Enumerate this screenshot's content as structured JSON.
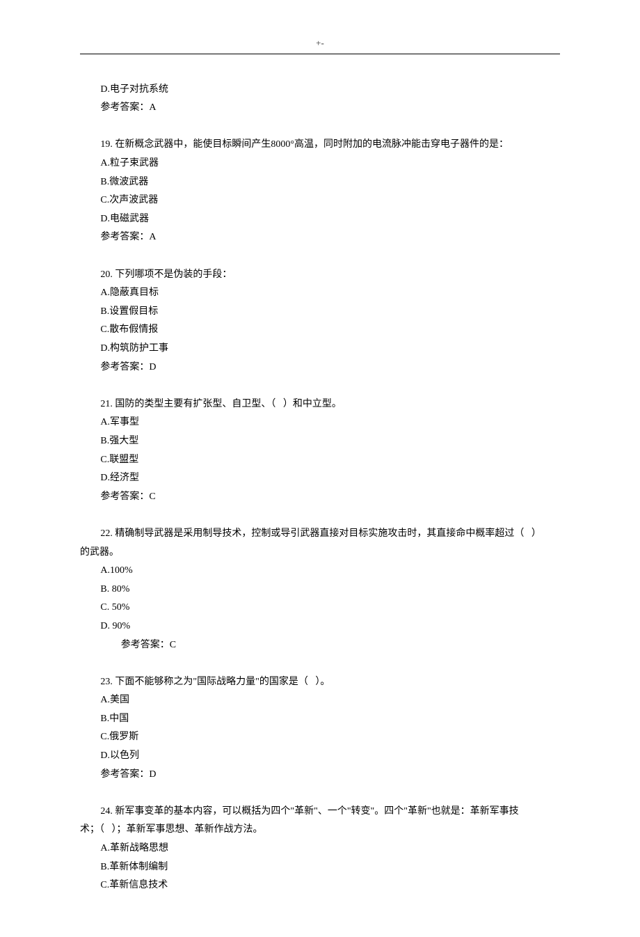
{
  "header": {
    "mark": "+-"
  },
  "pre": {
    "opt_d": "D.电子对抗系统",
    "answer": "参考答案：A"
  },
  "q19": {
    "stem": "19. 在新概念武器中，能使目标瞬间产生8000°高温，同时附加的电流脉冲能击穿电子器件的是：",
    "a": "A.粒子束武器",
    "b": "B.微波武器",
    "c": "C.次声波武器",
    "d": "D.电磁武器",
    "answer": "参考答案：A"
  },
  "q20": {
    "stem": "20. 下列哪项不是伪装的手段：",
    "a": "A.隐蔽真目标",
    "b": "B.设置假目标",
    "c": "C.散布假情报",
    "d": "D.构筑防护工事",
    "answer": "参考答案：D"
  },
  "q21": {
    "stem": "21. 国防的类型主要有扩张型、自卫型、（   ）和中立型。",
    "a": "A.军事型",
    "b": "B.强大型",
    "c": "C.联盟型",
    "d": "D.经济型",
    "answer": "参考答案：C"
  },
  "q22": {
    "stem_line1": "22. 精确制导武器是采用制导技术，控制或导引武器直接对目标实施攻击时，其直接命中概率超过（   ）",
    "stem_line2": "的武器。",
    "a": "A.100%",
    "b": "B. 80%",
    "c": "C. 50%",
    "d": "D. 90%",
    "answer": "参考答案：C"
  },
  "q23": {
    "stem": "23. 下面不能够称之为\"国际战略力量\"的国家是（   ）。",
    "a": "A.美国",
    "b": "B.中国",
    "c": "C.俄罗斯",
    "d": "D.以色列",
    "answer": "参考答案：D"
  },
  "q24": {
    "stem_line1": "24. 新军事变革的基本内容，可以概括为四个\"革新\"、一个\"转变\"。四个\"革新\"也就是：革新军事技",
    "stem_line2": "术；（   ）；革新军事思想、革新作战方法。",
    "a": "A.革新战略思想",
    "b": "B.革新体制编制",
    "c": "C.革新信息技术"
  }
}
